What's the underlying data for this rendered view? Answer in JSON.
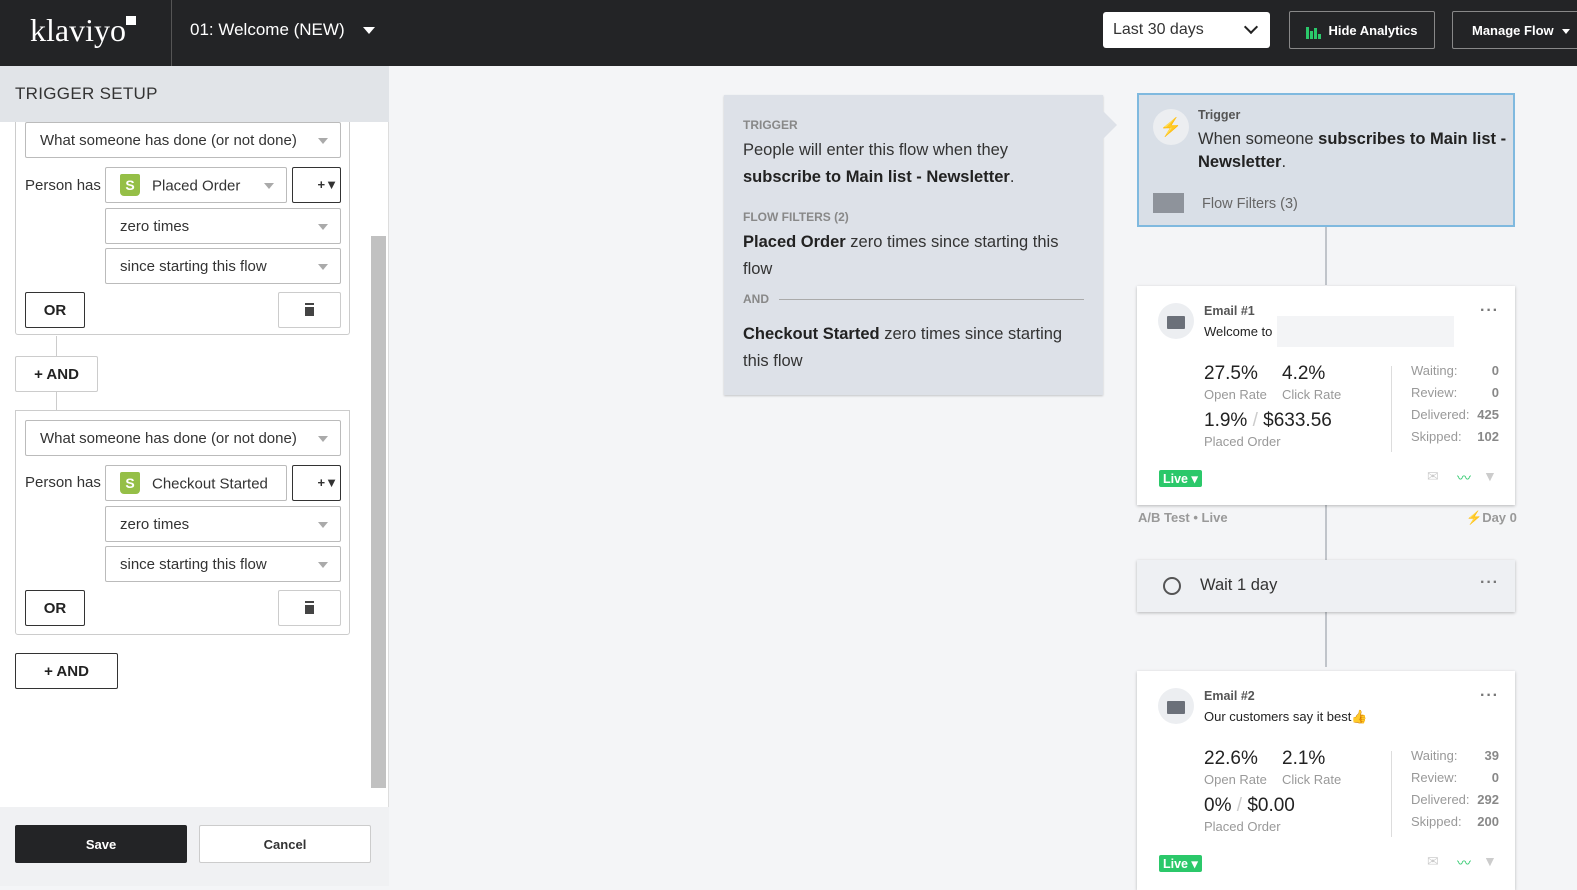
{
  "topbar": {
    "logo": "klaviyo",
    "flow_name": "01: Welcome (NEW)",
    "date_range": "Last 30 days",
    "hide_analytics": "Hide Analytics",
    "manage_flow": "Manage Flow",
    "accent": "#2bc86a"
  },
  "left": {
    "title": "TRIGGER SETUP",
    "groups": [
      {
        "type": "What someone has done (or not done)",
        "person_has": "Person has",
        "event": "Placed Order",
        "filter_btn": "+▼",
        "frequency": "zero times",
        "timeframe": "since starting this flow",
        "or": "OR"
      },
      {
        "type": "What someone has done (or not done)",
        "person_has": "Person has",
        "event": "Checkout Started",
        "filter_btn": "+▼",
        "frequency": "zero times",
        "timeframe": "since starting this flow",
        "or": "OR"
      }
    ],
    "and1": "+ AND",
    "and2": "+  AND",
    "save": "Save",
    "cancel": "Cancel"
  },
  "info": {
    "trigger_label": "TRIGGER",
    "trigger_pre": "People will enter this flow when they ",
    "trigger_bold": "subscribe to Main list - Newsletter",
    "trigger_post": ".",
    "filters_label": "FLOW FILTERS (2)",
    "f1_bold": "Placed Order",
    "f1_rest": " zero times since starting this flow",
    "and": "AND",
    "f2_bold": "Checkout Started",
    "f2_rest": " zero times since starting this flow"
  },
  "trigger_card": {
    "label": "Trigger",
    "pre": "When someone ",
    "bold": "subscribes to Main list - Newsletter",
    "post": ".",
    "filters": "Flow Filters (3)"
  },
  "emails": [
    {
      "title": "Email #1",
      "subject": "Welcome to",
      "open": "27.5%",
      "open_label": "Open Rate",
      "click": "4.2%",
      "click_label": "Click Rate",
      "conv": "1.9%",
      "revenue": "$633.56",
      "conv_label": "Placed Order",
      "waiting_l": "Waiting:",
      "waiting": "0",
      "review_l": "Review:",
      "review": "0",
      "delivered_l": "Delivered:",
      "delivered": "425",
      "skipped_l": "Skipped:",
      "skipped": "102",
      "status": "Live",
      "ab": "A/B Test • Live",
      "day": "Day 0"
    },
    {
      "title": "Email #2",
      "subject": "Our customers say it best👍",
      "open": "22.6%",
      "open_label": "Open Rate",
      "click": "2.1%",
      "click_label": "Click Rate",
      "conv": "0%",
      "revenue": "$0.00",
      "conv_label": "Placed Order",
      "waiting_l": "Waiting:",
      "waiting": "39",
      "review_l": "Review:",
      "review": "0",
      "delivered_l": "Delivered:",
      "delivered": "292",
      "skipped_l": "Skipped:",
      "skipped": "200",
      "status": "Live"
    }
  ],
  "wait": {
    "label": "Wait 1 day"
  }
}
